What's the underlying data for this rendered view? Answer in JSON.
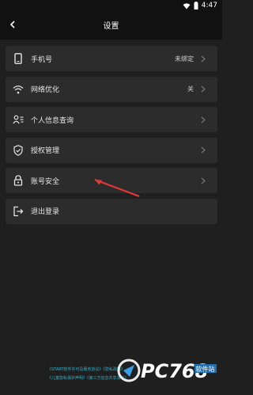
{
  "statusbar": {
    "time": "4:47"
  },
  "header": {
    "title": "设置"
  },
  "items": [
    {
      "label": "手机号",
      "value": "未绑定",
      "icon": "phone-icon"
    },
    {
      "label": "网络优化",
      "value": "关",
      "icon": "wifi-icon"
    },
    {
      "label": "个人信息查询",
      "value": "",
      "icon": "user-info-icon"
    },
    {
      "label": "授权管理",
      "value": "",
      "icon": "shield-icon"
    },
    {
      "label": "账号安全",
      "value": "",
      "icon": "lock-icon"
    },
    {
      "label": "退出登录",
      "value": "",
      "icon": "logout-icon"
    }
  ],
  "footer": {
    "line1": "《START软件许可及服务协议》《隐私政策》",
    "line2": "《儿童隐私保护声明》《第三方信息共享清单》"
  },
  "watermark": {
    "text": "PC768",
    "tag": "软件站"
  },
  "colors": {
    "background": "#1f1f1f",
    "row": "#2c2c2c",
    "accent_arrow": "#e53935",
    "link": "#2fb0c8"
  }
}
